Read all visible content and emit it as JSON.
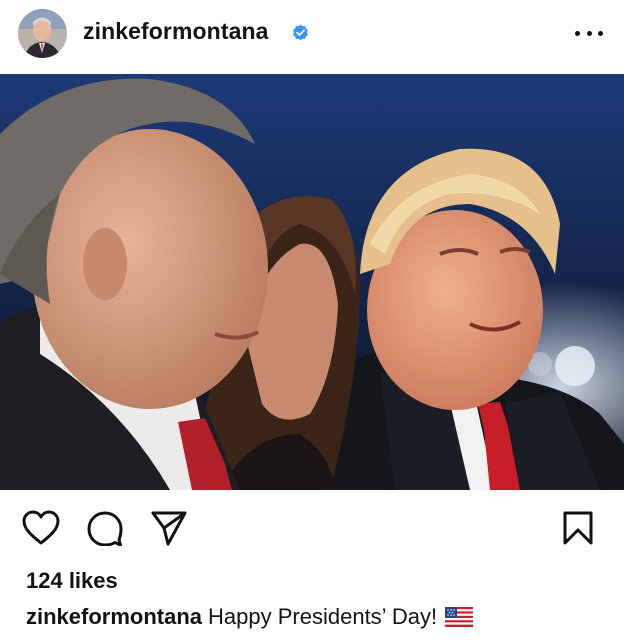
{
  "post": {
    "username": "zinkeformontana",
    "verified": true,
    "likes": "124 likes",
    "caption_user": "zinkeformontana",
    "caption_text": "Happy Presidents’ Day!",
    "caption_emoji": "us-flag"
  },
  "icons": {
    "like": "heart-icon",
    "comment": "comment-bubble-icon",
    "share": "paper-plane-icon",
    "save": "bookmark-icon",
    "more": "more-options-icon",
    "verified": "verified-badge-icon"
  },
  "colors": {
    "verified_badge": "#3897f0",
    "text": "#141414",
    "background": "#ffffff"
  }
}
